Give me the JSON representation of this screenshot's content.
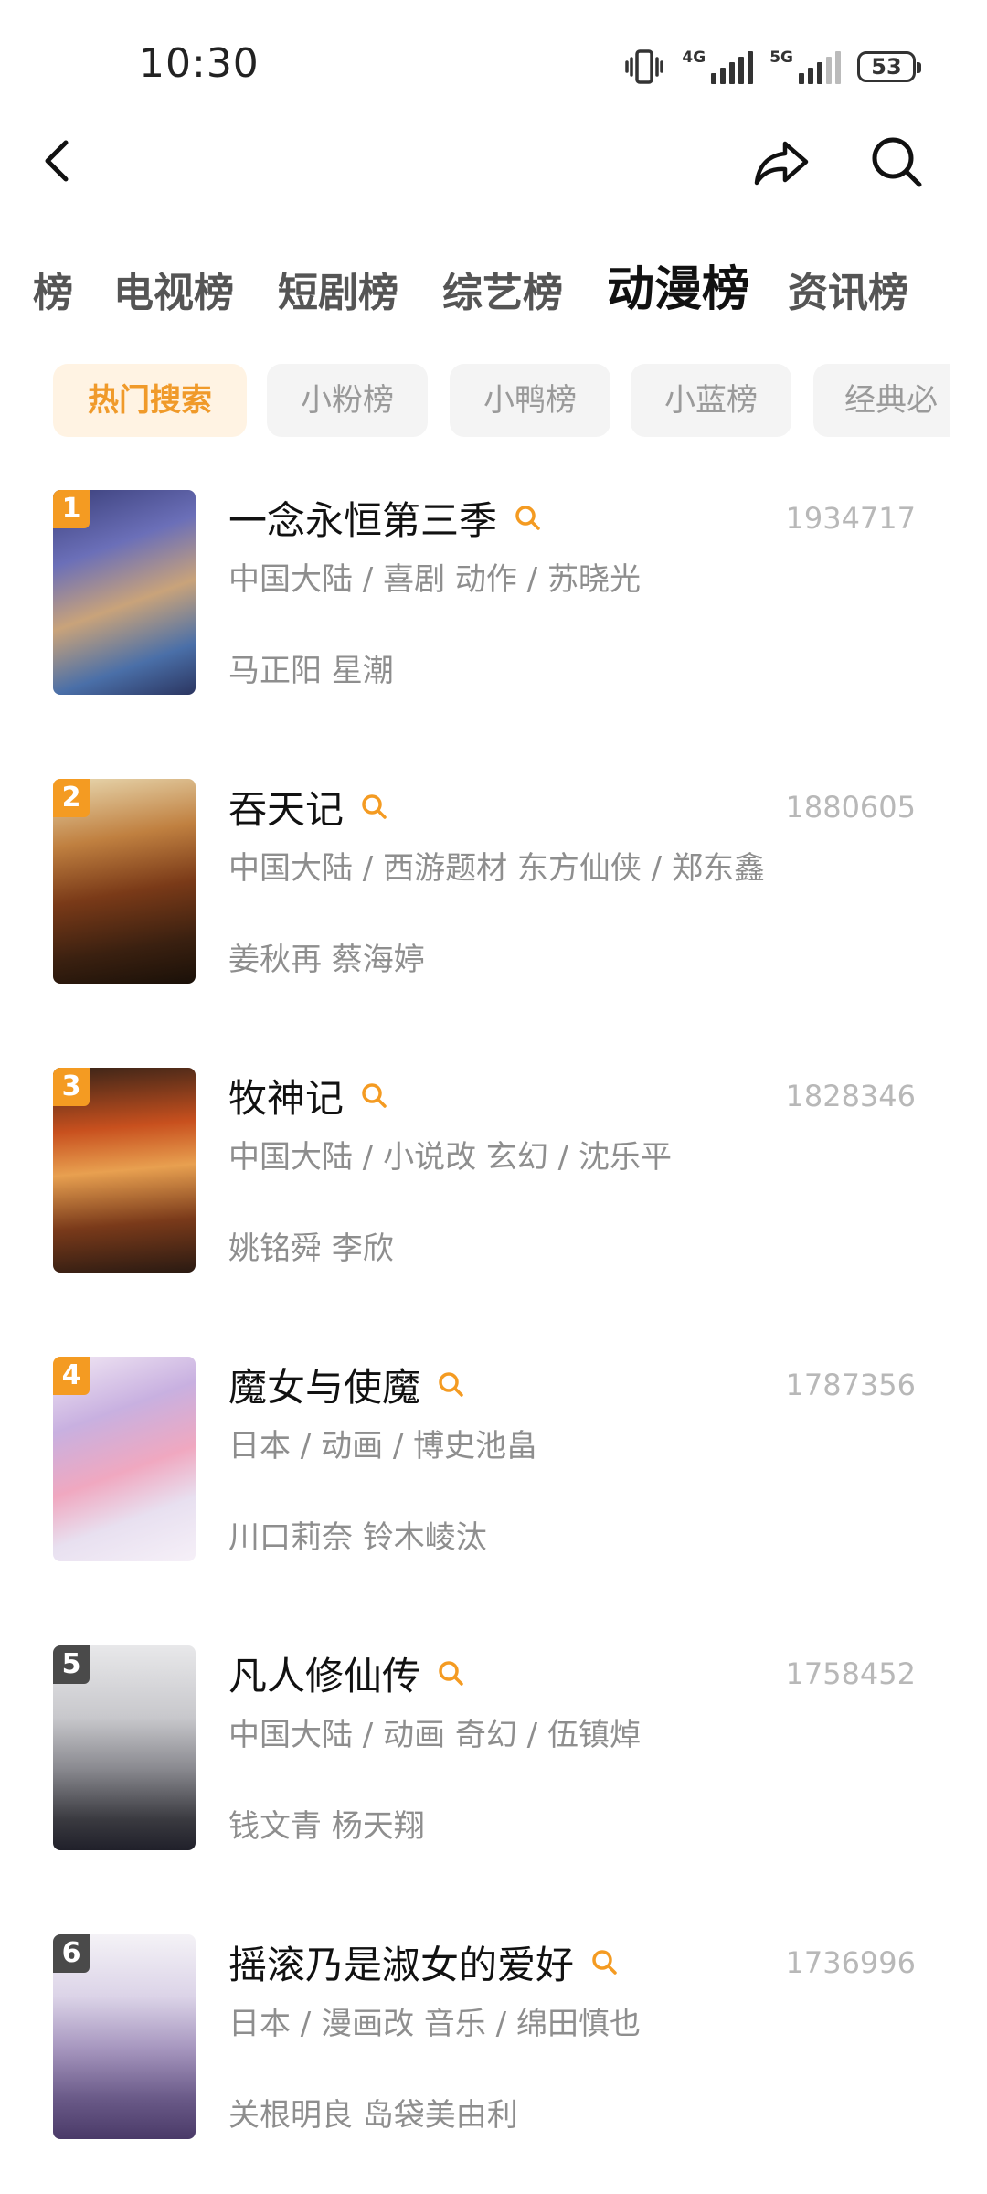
{
  "status_bar": {
    "time": "10:30",
    "net1": "4G",
    "net2": "5G",
    "battery": "53"
  },
  "tabs": [
    "榜",
    "电视榜",
    "短剧榜",
    "综艺榜",
    "动漫榜",
    "资讯榜"
  ],
  "active_tab": "动漫榜",
  "chips": [
    "热门搜索",
    "小粉榜",
    "小鸭榜",
    "小蓝榜",
    "经典必"
  ],
  "active_chip": "热门搜索",
  "colors": {
    "accent": "#f49b22",
    "chip_active_bg": "#fff3e3",
    "rank_gray": "#4a4a4a"
  },
  "items": [
    {
      "rank": "1",
      "title": "一念永恒第三季",
      "count": "1934717",
      "meta": "中国大陆 / 喜剧 动作 / 苏晓光",
      "cast": "马正阳 星潮"
    },
    {
      "rank": "2",
      "title": "吞天记",
      "count": "1880605",
      "meta": "中国大陆 / 西游题材 东方仙侠 / 郑东鑫",
      "cast": "姜秋再 蔡海婷"
    },
    {
      "rank": "3",
      "title": "牧神记",
      "count": "1828346",
      "meta": "中国大陆 / 小说改 玄幻 / 沈乐平",
      "cast": "姚铭舜 李欣"
    },
    {
      "rank": "4",
      "title": "魔女与使魔",
      "count": "1787356",
      "meta": "日本 / 动画 / 博史池畠",
      "cast": "川口莉奈 铃木崚汰"
    },
    {
      "rank": "5",
      "title": "凡人修仙传",
      "count": "1758452",
      "meta": "中国大陆 / 动画 奇幻 / 伍镇焯",
      "cast": "钱文青 杨天翔"
    },
    {
      "rank": "6",
      "title": "摇滚乃是淑女的爱好",
      "count": "1736996",
      "meta": "日本 / 漫画改 音乐 / 绵田慎也",
      "cast": "关根明良 岛袋美由利"
    }
  ]
}
